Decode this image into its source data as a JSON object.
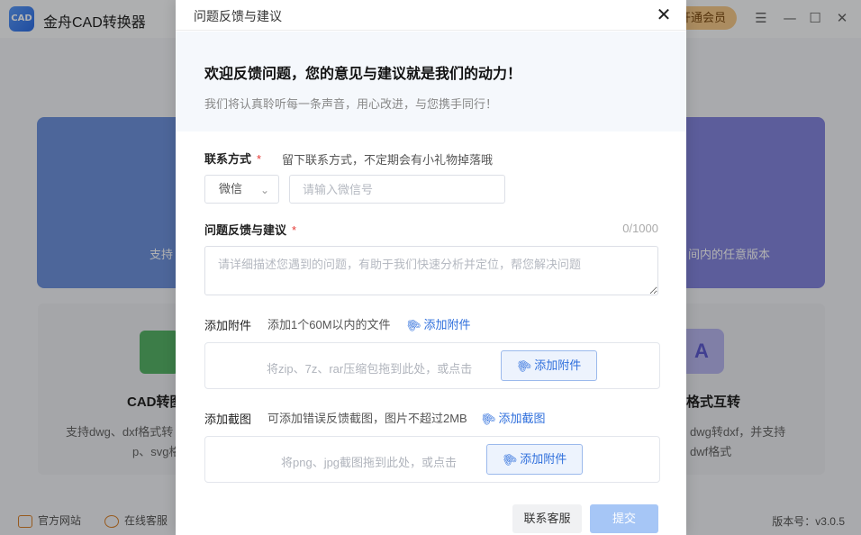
{
  "app": {
    "logo_text": "CAD",
    "title": "金舟CAD转换器",
    "vip_label": "开通会员",
    "banner_left_text": "支持",
    "banner_right_text": "间内的任意版本",
    "card_left": {
      "title": "CAD转图",
      "desc_line1": "支持dwg、dxf格式转",
      "desc_line2": "p、svg格"
    },
    "card_right": {
      "icon_text": "A",
      "title": "格式互转",
      "desc_line1": "dwg转dxf，并支持",
      "desc_line2": "dwf格式"
    },
    "footer": {
      "website": "官方网站",
      "online_service": "在线客服",
      "version": "版本号：v3.0.5"
    }
  },
  "modal": {
    "title": "问题反馈与建议",
    "close_glyph": "✕",
    "hero_title": "欢迎反馈问题，您的意见与建议就是我们的动力！",
    "hero_subtitle": "我们将认真聆听每一条声音，用心改进，与您携手同行！",
    "contact": {
      "label": "联系方式",
      "required_mark": "*",
      "hint": "留下联系方式，不定期会有小礼物掉落哦",
      "select_value": "微信",
      "input_placeholder": "请输入微信号"
    },
    "feedback": {
      "label": "问题反馈与建议",
      "required_mark": "*",
      "counter": "0/1000",
      "placeholder": "请详细描述您遇到的问题，有助于我们快速分析并定位，帮您解决问题"
    },
    "attachment": {
      "label": "添加附件",
      "hint": "添加1个60M以内的文件",
      "link": "添加附件",
      "drop_text": "将zip、7z、rar压缩包拖到此处，或点击",
      "button": "添加附件"
    },
    "screenshot": {
      "label": "添加截图",
      "hint": "可添加错误反馈截图，图片不超过2MB",
      "link": "添加截图",
      "drop_text": "将png、jpg截图拖到此处，或点击",
      "button": "添加附件"
    },
    "buttons": {
      "service": "联系客服",
      "submit": "提交"
    }
  }
}
